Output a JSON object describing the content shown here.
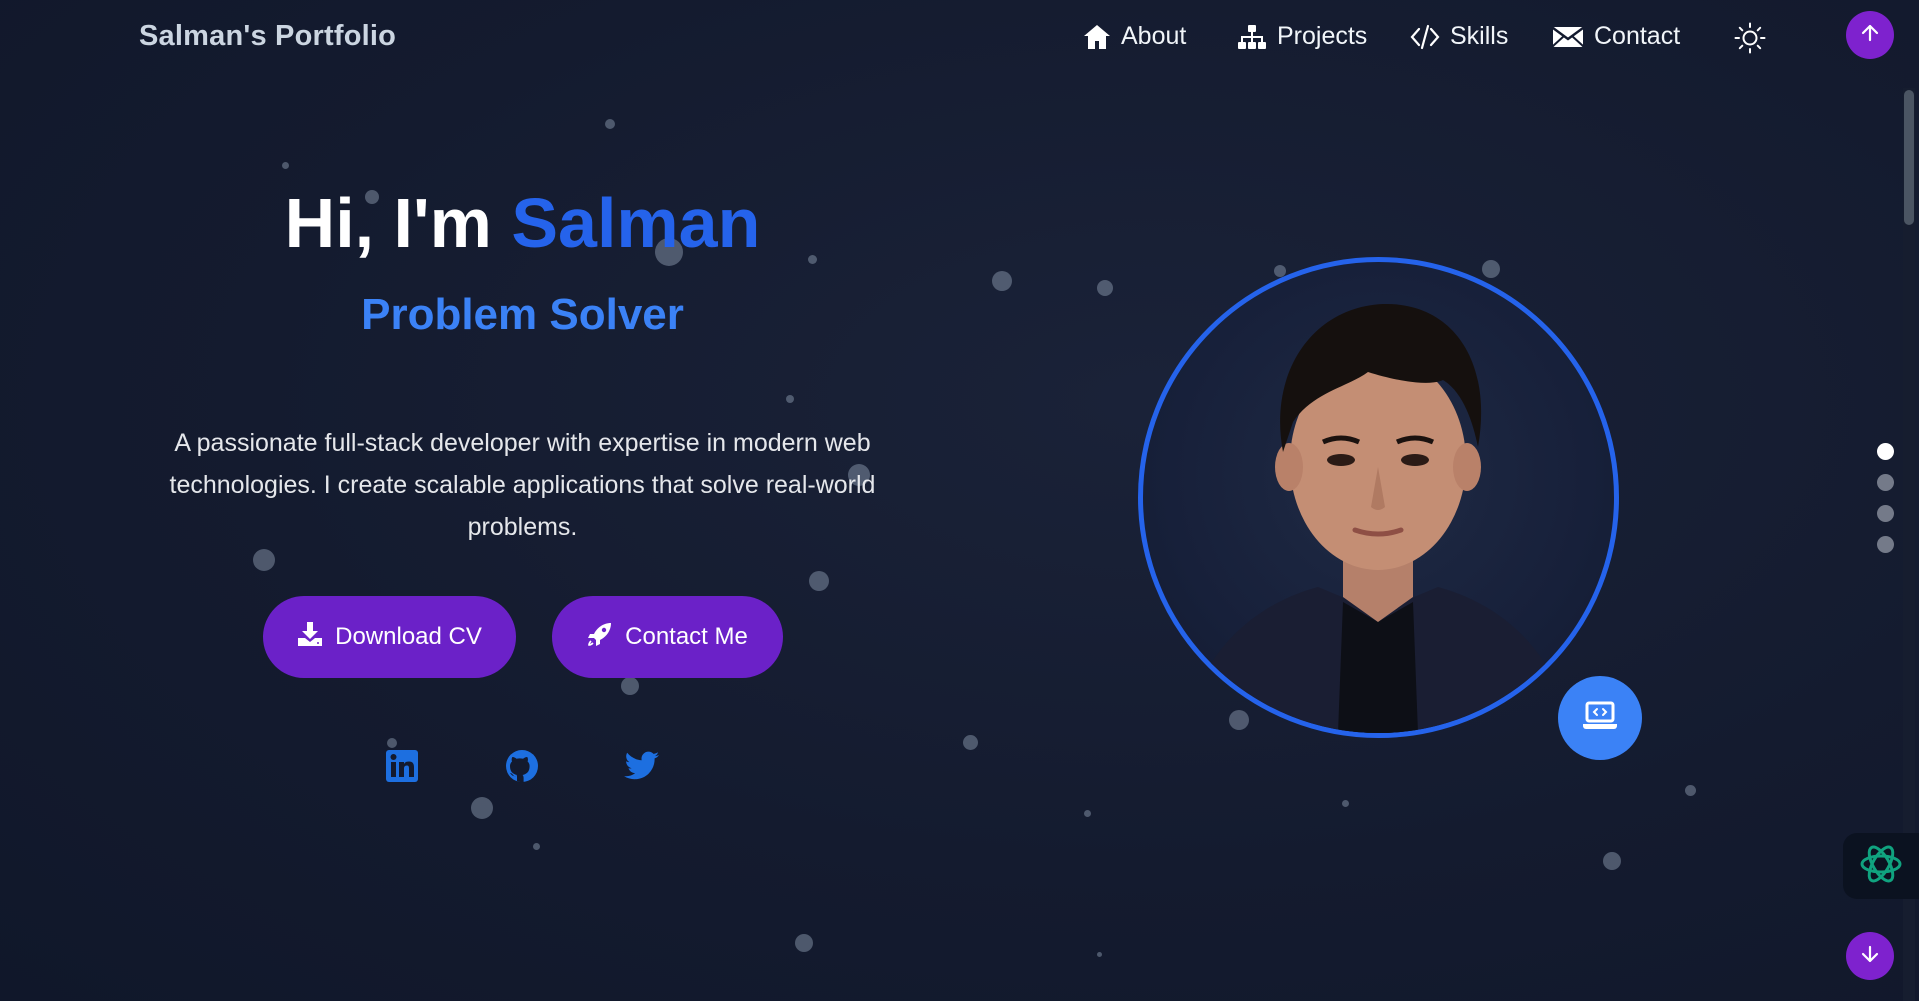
{
  "header": {
    "brand": "Salman's Portfolio",
    "nav": [
      {
        "label": "About",
        "icon": "home-icon"
      },
      {
        "label": "Projects",
        "icon": "sitemap-icon"
      },
      {
        "label": "Skills",
        "icon": "code-icon"
      },
      {
        "label": "Contact",
        "icon": "envelope-icon"
      }
    ],
    "theme_toggle_icon": "sun-icon"
  },
  "hero": {
    "greeting": "Hi, I'm ",
    "name": "Salman",
    "role": "Problem Solver",
    "description": "A passionate full-stack developer with expertise in modern web technologies. I create scalable applications that solve real-world problems.",
    "buttons": [
      {
        "label": "Download CV",
        "icon": "download-icon"
      },
      {
        "label": "Contact Me",
        "icon": "rocket-icon"
      }
    ],
    "social": [
      {
        "name": "linkedin-icon"
      },
      {
        "name": "github-icon"
      },
      {
        "name": "twitter-icon"
      }
    ]
  },
  "side_nav": {
    "sections": 4,
    "active_index": 0
  },
  "colors": {
    "background": "#131a2e",
    "accent_blue": "#2563eb",
    "purple": "#6b21c8",
    "text": "#f1f5f9"
  }
}
